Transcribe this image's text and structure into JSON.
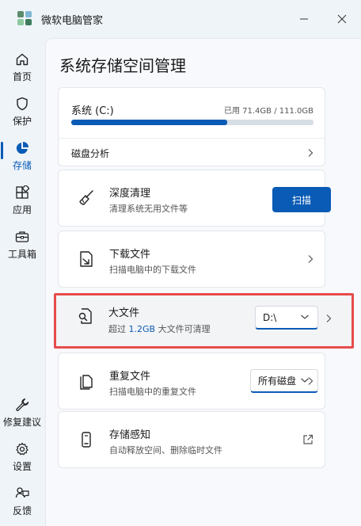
{
  "app": {
    "title": "微软电脑管家"
  },
  "window_controls": {
    "minimize_icon": "minimize-icon",
    "close_icon": "close-icon"
  },
  "sidebar": {
    "items": [
      {
        "label": "首页",
        "icon": "home-icon"
      },
      {
        "label": "保护",
        "icon": "shield-icon"
      },
      {
        "label": "存储",
        "icon": "pie-chart-icon",
        "active": true
      },
      {
        "label": "应用",
        "icon": "apps-icon"
      },
      {
        "label": "工具箱",
        "icon": "toolbox-icon"
      },
      {
        "label": "修复建议",
        "icon": "wrench-icon"
      },
      {
        "label": "设置",
        "icon": "gear-icon"
      },
      {
        "label": "反馈",
        "icon": "feedback-icon"
      }
    ]
  },
  "main": {
    "title": "系统存储空间管理",
    "drive": {
      "name": "系统 (C:)",
      "usage": "已用 71.4GB / 111.0GB",
      "used_gb": 71.4,
      "total_gb": 111.0,
      "analysis_label": "磁盘分析"
    },
    "deep_clean": {
      "title": "深度清理",
      "desc": "清理系统无用文件等",
      "button": "扫描"
    },
    "downloads": {
      "title": "下载文件",
      "desc": "扫描电脑中的下载文件"
    },
    "large_files": {
      "title": "大文件",
      "desc_prefix": "超过 ",
      "desc_size": "1.2GB",
      "desc_suffix": " 大文件可清理",
      "selected_drive": "D:\\"
    },
    "duplicates": {
      "title": "重复文件",
      "desc": "扫描电脑中的重复文件",
      "selected_scope": "所有磁盘"
    },
    "storage_sense": {
      "title": "存储感知",
      "desc": "自动释放空间、删除临时文件"
    }
  },
  "colors": {
    "accent": "#0a5bb5",
    "highlight_border": "#e74c4c",
    "background": "#eff4f9"
  }
}
